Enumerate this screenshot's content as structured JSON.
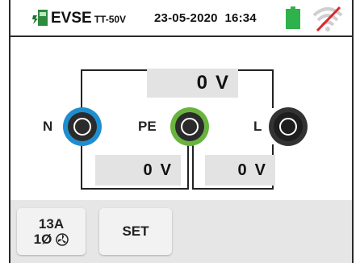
{
  "status_bar": {
    "mode": "EVSE",
    "system": "TT-50V",
    "date": "23-05-2020",
    "time": "16:34",
    "battery_color": "#2fb24b",
    "wifi_state": "disabled"
  },
  "measurements": {
    "top": {
      "value": "0",
      "unit": "V"
    },
    "left": {
      "value": "0",
      "unit": "V"
    },
    "right": {
      "value": "0",
      "unit": "V"
    }
  },
  "terminals": [
    {
      "label": "N",
      "ring_color": "#1f8ed1"
    },
    {
      "label": "PE",
      "ring_color": "#69b33f"
    },
    {
      "label": "L",
      "ring_color": "#333333"
    }
  ],
  "softkeys": {
    "current": {
      "line1": "13A",
      "line2": "1Ø"
    },
    "set_label": "SET"
  }
}
